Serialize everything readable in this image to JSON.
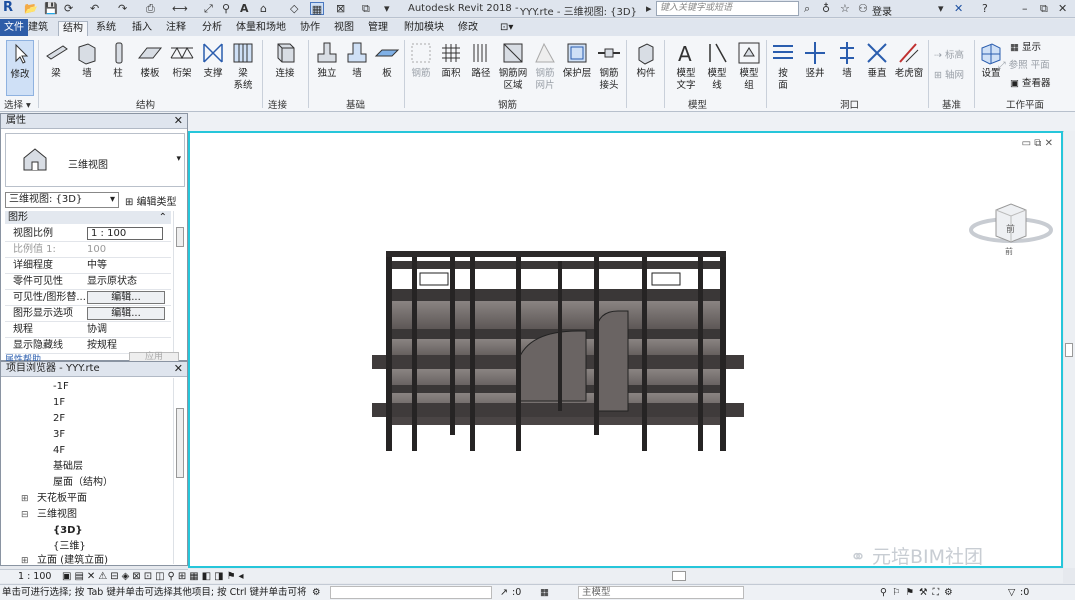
{
  "app": {
    "logo": "R",
    "title": "Autodesk Revit 2018 -",
    "document": "YYY.rte - 三维视图: {3D}",
    "search_placeholder": "键入关键字或短语",
    "login": "登录"
  },
  "tabs": [
    "文件",
    "建筑",
    "结构",
    "系统",
    "插入",
    "注释",
    "分析",
    "体量和场地",
    "协作",
    "视图",
    "管理",
    "附加模块",
    "修改"
  ],
  "active_tab": "结构",
  "ribbon": {
    "buttons": [
      {
        "label": "修改",
        "group": "选择"
      },
      {
        "label": "梁"
      },
      {
        "label": "墙"
      },
      {
        "label": "柱"
      },
      {
        "label": "楼板"
      },
      {
        "label": "桁架"
      },
      {
        "label": "支撑"
      },
      {
        "label": "梁\n系统"
      },
      {
        "label": "连接"
      },
      {
        "label": "独立"
      },
      {
        "label": "墙"
      },
      {
        "label": "板"
      },
      {
        "label": "钢筋"
      },
      {
        "label": "面积"
      },
      {
        "label": "路径"
      },
      {
        "label": "钢筋网\n区域"
      },
      {
        "label": "钢筋\n网片"
      },
      {
        "label": "保护层"
      },
      {
        "label": "钢筋\n接头"
      },
      {
        "label": "构件"
      },
      {
        "label": "模型\n文字"
      },
      {
        "label": "模型\n线"
      },
      {
        "label": "模型\n组"
      },
      {
        "label": "按\n面"
      },
      {
        "label": "竖井"
      },
      {
        "label": "墙"
      },
      {
        "label": "垂直"
      },
      {
        "label": "老虎窗"
      },
      {
        "label": "设置"
      }
    ],
    "groups": [
      "选择",
      "结构",
      "连接",
      "基础",
      "钢筋",
      "模型",
      "洞口",
      "基准",
      "工作平面"
    ],
    "small": {
      "datum_level": "标高",
      "datum_grid": "轴网",
      "ref_plane": "参照 平面",
      "show": "显示",
      "viewer": "查看器"
    }
  },
  "properties": {
    "title": "属性",
    "type_name": "三维视图",
    "view_selector": "三维视图: {3D}",
    "edit_type": "编辑类型",
    "section": "图形",
    "rows": [
      {
        "k": "视图比例",
        "v": "1 : 100",
        "kind": "box"
      },
      {
        "k": "比例值 1:",
        "v": "100",
        "kind": "gray"
      },
      {
        "k": "详细程度",
        "v": "中等"
      },
      {
        "k": "零件可见性",
        "v": "显示原状态"
      },
      {
        "k": "可见性/图形替...",
        "v": "编辑...",
        "kind": "btn"
      },
      {
        "k": "图形显示选项",
        "v": "编辑...",
        "kind": "btn"
      },
      {
        "k": "规程",
        "v": "协调"
      },
      {
        "k": "显示隐藏线",
        "v": "按规程"
      }
    ],
    "help": "属性帮助",
    "apply": "应用"
  },
  "browser": {
    "title": "项目浏览器 - YYY.rte",
    "items": [
      "-1F",
      "1F",
      "2F",
      "3F",
      "4F",
      "基础层",
      "屋面（结构）",
      "天花板平面",
      "三维视图",
      "{3D}",
      "{三维}",
      "立面 (建筑立面)"
    ]
  },
  "viewcube": {
    "face": "前",
    "bottom": "前"
  },
  "view_control": {
    "scale": "1 : 100"
  },
  "status": {
    "text": "单击可进行选择; 按 Tab 键并单击可选择其他项目; 按 Ctrl 键并单击可将",
    "count1": ":0",
    "model": "主模型",
    "count2": ":0"
  },
  "watermark": "元培BIM社团"
}
